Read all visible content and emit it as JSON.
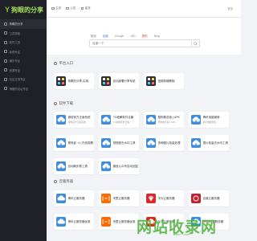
{
  "brand": {
    "mark": "Y",
    "name": "狗眼的分享"
  },
  "sidebar": {
    "items": [
      {
        "label": "狗眼的分享"
      },
      {
        "label": "工具导航"
      },
      {
        "label": "软件工具"
      },
      {
        "label": "影视专区"
      },
      {
        "label": "娱乐专区"
      },
      {
        "label": "资源专区"
      },
      {
        "label": "社区交流专区"
      },
      {
        "label": "狗眼的论坛专区"
      }
    ]
  },
  "topbar": {
    "items": [
      {
        "label": "主页"
      },
      {
        "label": "公告"
      },
      {
        "label": "留言"
      }
    ],
    "right": "登录"
  },
  "search": {
    "tabs": [
      {
        "label": "常用"
      },
      {
        "label": "百度"
      },
      {
        "label": "Google"
      },
      {
        "label": "360"
      },
      {
        "label": "搜狗"
      },
      {
        "label": "Bing"
      }
    ],
    "active_tab": 1,
    "placeholder": "百度一下"
  },
  "sections": [
    {
      "title": "平台入口"
    },
    {
      "title": "软件下载"
    },
    {
      "title": "云服务器"
    }
  ],
  "cards": [
    {
      "title": "狗眼的分享-实用导航",
      "desc": "",
      "icon": "grid-icon",
      "color": "#2b2f36"
    },
    {
      "title": "自动部署分享系统",
      "desc": "",
      "icon": "grid-icon",
      "color": "#2b2f36"
    },
    {
      "title": "视频剪辑教程",
      "desc": "",
      "icon": "grid-icon",
      "color": "#2b2f36"
    },
    {
      "title": "微软官方正版系统",
      "desc": "微软官方正版系统...",
      "icon": "cloud-download-icon",
      "color": "#3f8de0"
    },
    {
      "title": "PC破解软件合集",
      "desc": "PC破解软件合集...",
      "icon": "cloud-download-icon",
      "color": "#3f8de0"
    },
    {
      "title": "酷狗概念版 | APK",
      "desc": "酷狗概念版 | APK...",
      "icon": "cloud-download-icon",
      "color": "#3f8de0"
    },
    {
      "title": "腾讯电脑管家",
      "desc": "腾讯电脑管家...",
      "icon": "cloud-download-icon",
      "color": "#3f8de0"
    },
    {
      "title": "看电影 ·4 | 在线观看",
      "desc": "",
      "icon": "cloud-download-icon",
      "color": "#3f8de0"
    },
    {
      "title": "短视频去水印工具",
      "desc": "",
      "icon": "cloud-download-icon",
      "color": "#3f8de0"
    },
    {
      "title": "多种图片批量处理",
      "desc": "",
      "icon": "cloud-download-icon",
      "color": "#3f8de0"
    },
    {
      "title": "图片批量去水印工具",
      "desc": "",
      "icon": "cloud-download-icon",
      "color": "#3f8de0"
    },
    {
      "title": "自动刷步数工具",
      "desc": "",
      "icon": "cloud-download-icon",
      "color": "#3f8de0"
    },
    {
      "title": "微信公众号自动回复",
      "desc": "",
      "icon": "cloud-download-icon",
      "color": "#3f8de0"
    },
    {
      "title": "腾讯云服务器",
      "desc": "",
      "icon": "tencent-cloud-icon",
      "color": "#3f8de0"
    },
    {
      "title": "阿里云服务器",
      "desc": "",
      "icon": "aliyun-icon",
      "color": "#ff6a00"
    },
    {
      "title": "华为云服务器",
      "desc": "",
      "icon": "huawei-cloud-icon",
      "color": "#e0252a"
    },
    {
      "title": "百度云服务器",
      "desc": "",
      "icon": "baidu-cloud-icon",
      "color": "#c21f2f"
    },
    {
      "title": "腾讯云服务器优惠",
      "desc": "",
      "icon": "tencent-cloud-icon",
      "color": "#3f8de0"
    },
    {
      "title": "阿里云服务器优惠",
      "desc": "",
      "icon": "aliyun-icon",
      "color": "#ff6a00"
    },
    {
      "title": "京东云服务器",
      "desc": "",
      "icon": "jd-cloud-icon",
      "color": "#e1251b"
    },
    {
      "title": "UCloud云服务器",
      "desc": "",
      "icon": "ucloud-icon",
      "color": "#3f8de0"
    }
  ],
  "watermark": {
    "text": "网站收录网",
    "sub": "www.***.com"
  }
}
